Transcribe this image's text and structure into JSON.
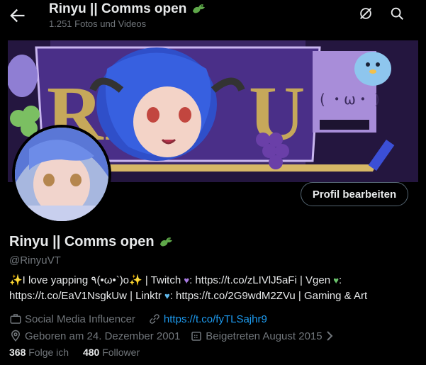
{
  "header": {
    "title": "Rinyu || Comms open",
    "subtitle": "1.251 Fotos und Videos"
  },
  "banner": {
    "text_left": "RI",
    "text_right": "U",
    "kaomoji": "(  ・ω・  )"
  },
  "profile": {
    "edit_button": "Profil bearbeiten",
    "name": "Rinyu || Comms open",
    "handle": "@RinyuVT",
    "bio": {
      "p1": "✨I love yapping ٩(•ω•`)o✨ | Twitch ",
      "p2": ": https://t.co/zLIVlJ5aFi | Vgen ",
      "p3": ":",
      "p4": "https://t.co/EaV1NsgkUw | Linktr ",
      "p5": ": https://t.co/2G9wdM2ZVu | Gaming & Art"
    },
    "category": "Social Media Influencer",
    "website": "https://t.co/fyTLSajhr9",
    "birthday": "Geboren am 24. Dezember 2001",
    "joined": "Beigetreten August 2015",
    "following_count": "368",
    "following_label": "Folge ich",
    "followers_count": "480",
    "followers_label": "Follower"
  },
  "colors": {
    "accent": "#1d9bf0",
    "secondary_text": "#71767b",
    "heart_purple": "#a97ce4",
    "heart_green": "#6bc46d",
    "heart_blue": "#5fb8ec"
  }
}
